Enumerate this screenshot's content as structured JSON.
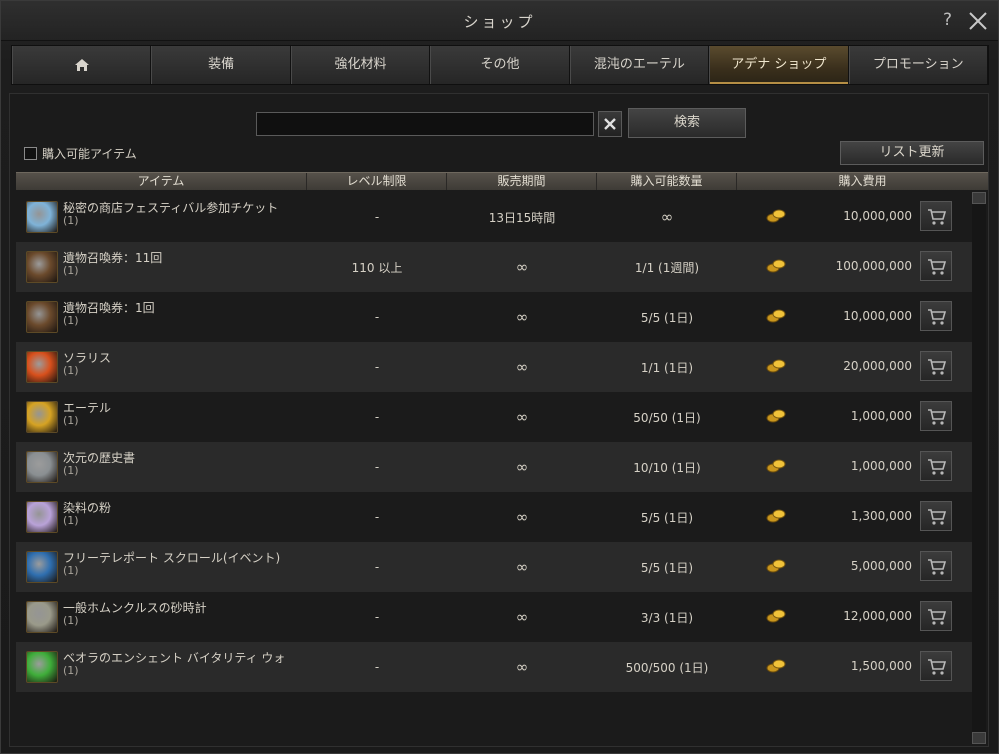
{
  "window": {
    "title": "ショップ",
    "help": "?"
  },
  "tabs": [
    {
      "label": ""
    },
    {
      "label": "装備"
    },
    {
      "label": "強化材料"
    },
    {
      "label": "その他"
    },
    {
      "label": "混沌のエーテル"
    },
    {
      "label": "アデナ ショップ",
      "active": true
    },
    {
      "label": "プロモーション"
    }
  ],
  "search": {
    "value": "",
    "placeholder": "",
    "button": "検索"
  },
  "filter": {
    "label": "購入可能アイテム",
    "checked": false
  },
  "refresh": {
    "label": "リスト更新"
  },
  "columns": [
    "アイテム",
    "レベル制限",
    "販売期間",
    "購入可能数量",
    "購入費用"
  ],
  "items": [
    {
      "name": "秘密の商店フェスティバル参加チケット",
      "qty": "(1)",
      "level": "-",
      "period": "13日15時間",
      "limit": "∞",
      "price": "10,000,000",
      "icon": "ticket-icon",
      "color": "#7fb3d8"
    },
    {
      "name": "遺物召喚券：11回",
      "qty": "(1)",
      "level": "110 以上",
      "period": "∞",
      "limit": "1/1 (1週間)",
      "price": "100,000,000",
      "icon": "relic-scroll-icon",
      "color": "#6b4a2c"
    },
    {
      "name": "遺物召喚券：1回",
      "qty": "(1)",
      "level": "-",
      "period": "∞",
      "limit": "5/5 (1日)",
      "price": "10,000,000",
      "icon": "relic-scroll-icon",
      "color": "#6b4a2c"
    },
    {
      "name": "ソラリス",
      "qty": "(1)",
      "level": "-",
      "period": "∞",
      "limit": "1/1 (1日)",
      "price": "20,000,000",
      "icon": "sun-orb-icon",
      "color": "#d8501c"
    },
    {
      "name": "エーテル",
      "qty": "(1)",
      "level": "-",
      "period": "∞",
      "limit": "50/50 (1日)",
      "price": "1,000,000",
      "icon": "gold-orb-icon",
      "color": "#d6a323"
    },
    {
      "name": "次元の歴史書",
      "qty": "(1)",
      "level": "-",
      "period": "∞",
      "limit": "10/10 (1日)",
      "price": "1,000,000",
      "icon": "scroll-book-icon",
      "color": "#8a8f92"
    },
    {
      "name": "染料の粉",
      "qty": "(1)",
      "level": "-",
      "period": "∞",
      "limit": "5/5 (1日)",
      "price": "1,300,000",
      "icon": "dye-powder-icon",
      "color": "#b9a2d8"
    },
    {
      "name": "フリーテレポート スクロール(イベント)",
      "qty": "(1)",
      "level": "-",
      "period": "∞",
      "limit": "5/5 (1日)",
      "price": "5,000,000",
      "icon": "teleport-scroll-icon",
      "color": "#2f6fb0"
    },
    {
      "name": "一般ホムンクルスの砂時計",
      "qty": "(1)",
      "level": "-",
      "period": "∞",
      "limit": "3/3 (1日)",
      "price": "12,000,000",
      "icon": "hourglass-icon",
      "color": "#9a9a8a"
    },
    {
      "name": "ベオラのエンシェント バイタリティ ウォ",
      "qty": "(1)",
      "level": "-",
      "period": "∞",
      "limit": "500/500 (1日)",
      "price": "1,500,000",
      "icon": "potion-icon",
      "color": "#3fae3a"
    }
  ]
}
